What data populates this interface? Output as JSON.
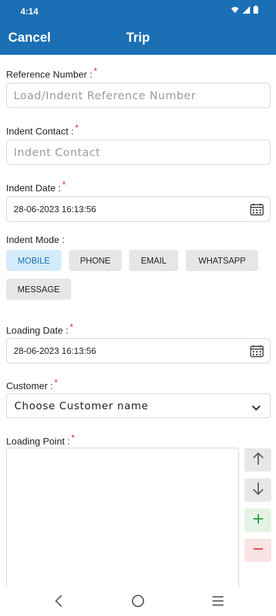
{
  "status_bar": {
    "time": "4:14",
    "icons": [
      "wifi-icon",
      "signal-icon",
      "battery-icon"
    ]
  },
  "app_bar": {
    "cancel_label": "Cancel",
    "title": "Trip",
    "background_color": "#1a6fb5"
  },
  "form": {
    "reference_number": {
      "label": "Reference Number :",
      "required_mark": "*",
      "placeholder": "Load/Indent Reference Number",
      "value": ""
    },
    "indent_contact": {
      "label": "Indent Contact :",
      "required_mark": "*",
      "placeholder": "Indent Contact",
      "value": ""
    },
    "indent_date": {
      "label": "Indent Date :",
      "required_mark": "*",
      "value": "28-06-2023 16:13:56",
      "icon": "calendar-icon"
    },
    "indent_mode": {
      "label": "Indent Mode :",
      "options": [
        "MOBILE",
        "PHONE",
        "EMAIL",
        "WHATSAPP",
        "MESSAGE"
      ],
      "selected": "MOBILE"
    },
    "loading_date": {
      "label": "Loading Date :",
      "required_mark": "*",
      "value": "28-06-2023 16:13:56",
      "icon": "calendar-icon"
    },
    "customer": {
      "label": "Customer :",
      "required_mark": "*",
      "selected": "Choose Customer name",
      "icon": "chevron-down-icon"
    },
    "loading_point": {
      "label": "Loading Point :",
      "required_mark": "*",
      "value": "",
      "actions": [
        "arrow-up-icon",
        "arrow-down-icon",
        "plus-icon",
        "minus-icon"
      ]
    }
  },
  "nav_bar": {
    "icons": [
      "back-icon",
      "home-icon",
      "menu-icon"
    ]
  },
  "colors": {
    "accent": "#1a6fb5",
    "required": "#e0201e",
    "chip_selected_bg": "#d4ecfa",
    "chip_bg": "#e6e6e6",
    "add_green": "#2e9e3e",
    "remove_red": "#e0414a"
  }
}
